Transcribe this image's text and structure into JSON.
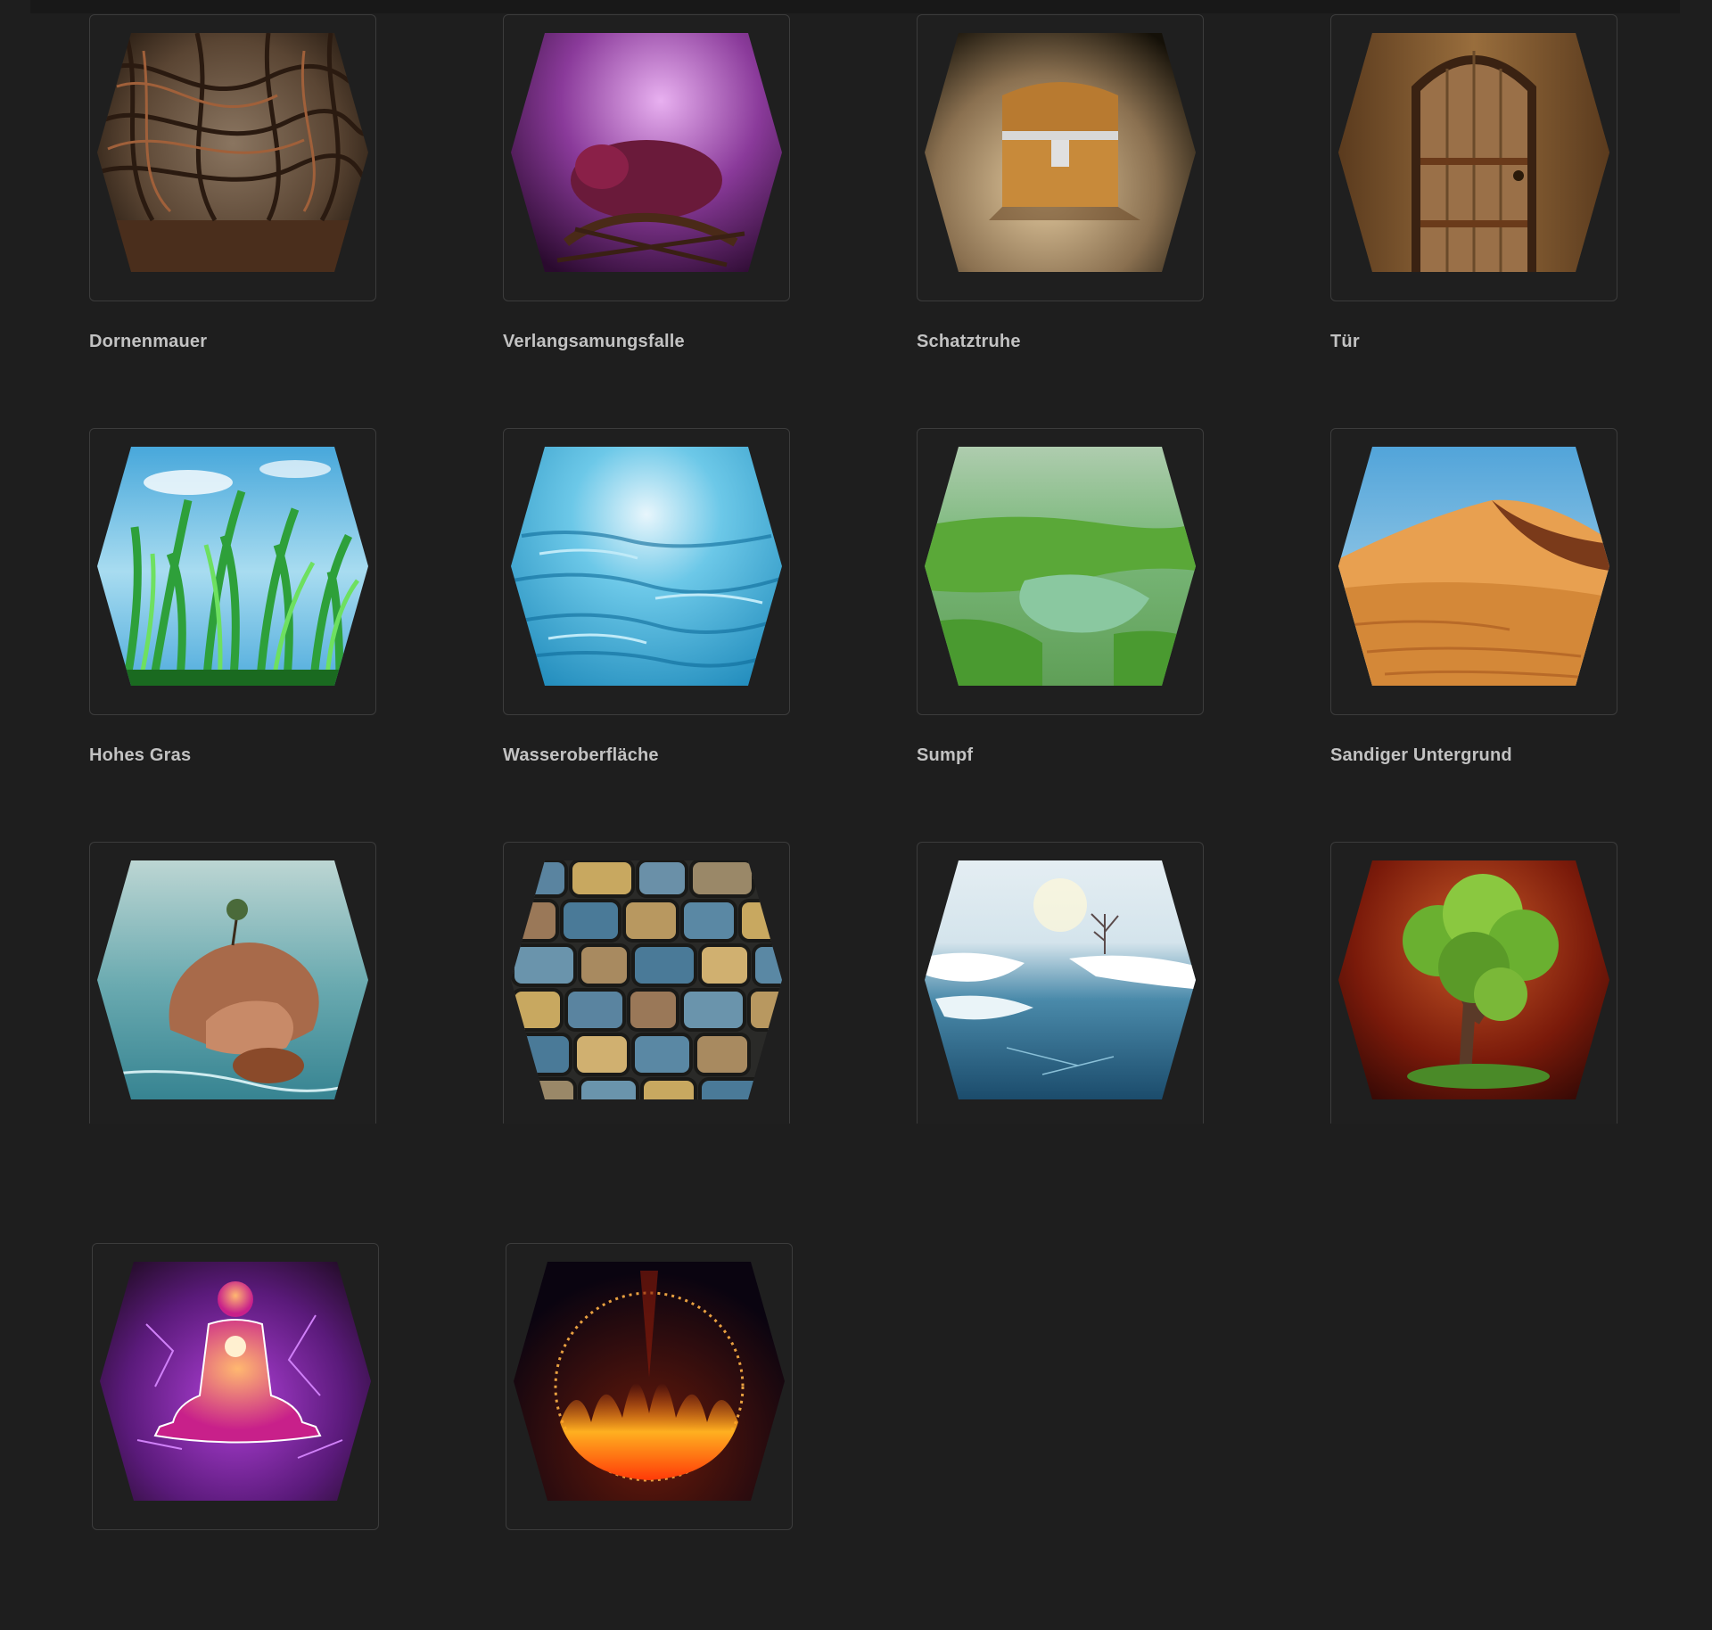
{
  "gallery": {
    "items": [
      {
        "label": "Dornenmauer",
        "icon": "thorn-wall-icon"
      },
      {
        "label": "Verlangsamungsfalle",
        "icon": "slow-trap-icon"
      },
      {
        "label": "Schatztruhe",
        "icon": "treasure-chest-icon"
      },
      {
        "label": "Tür",
        "icon": "door-icon"
      },
      {
        "label": "Hohes Gras",
        "icon": "tall-grass-icon"
      },
      {
        "label": "Wasseroberfläche",
        "icon": "water-surface-icon"
      },
      {
        "label": "Sumpf",
        "icon": "swamp-icon"
      },
      {
        "label": "Sandiger Untergrund",
        "icon": "sandy-ground-icon"
      },
      {
        "label": "",
        "icon": "rock-in-water-icon"
      },
      {
        "label": "",
        "icon": "stone-floor-icon"
      },
      {
        "label": "",
        "icon": "frozen-lake-icon"
      },
      {
        "label": "",
        "icon": "tree-icon"
      },
      {
        "label": "",
        "icon": "meditation-icon"
      },
      {
        "label": "",
        "icon": "fire-ring-icon"
      }
    ]
  }
}
